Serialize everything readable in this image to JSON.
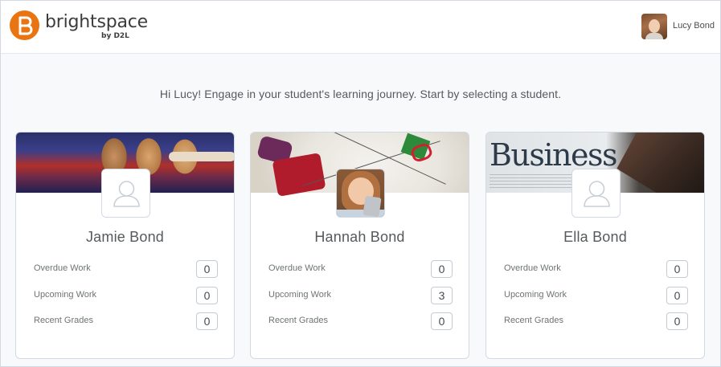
{
  "header": {
    "logo_text": "brightspace",
    "logo_sub": "by D2L",
    "user_name": "Lucy Bond"
  },
  "greeting": "Hi Lucy! Engage in your student's learning journey. Start by selecting a student.",
  "stat_labels": {
    "overdue": "Overdue Work",
    "upcoming": "Upcoming Work",
    "grades": "Recent Grades"
  },
  "students": [
    {
      "name": "Jamie Bond",
      "overdue": "0",
      "upcoming": "0",
      "grades": "0",
      "avatar": "placeholder-person-icon",
      "banner": "abacus"
    },
    {
      "name": "Hannah Bond",
      "overdue": "0",
      "upcoming": "3",
      "grades": "0",
      "avatar": "photo",
      "banner": "craft"
    },
    {
      "name": "Ella Bond",
      "overdue": "0",
      "upcoming": "0",
      "grades": "0",
      "avatar": "placeholder-person-icon",
      "banner": "newspaper"
    }
  ],
  "banner_text": {
    "newspaper": "Business"
  },
  "colors": {
    "brand": "#e87511",
    "text": "#565a5c",
    "border": "#d3d9e3"
  }
}
